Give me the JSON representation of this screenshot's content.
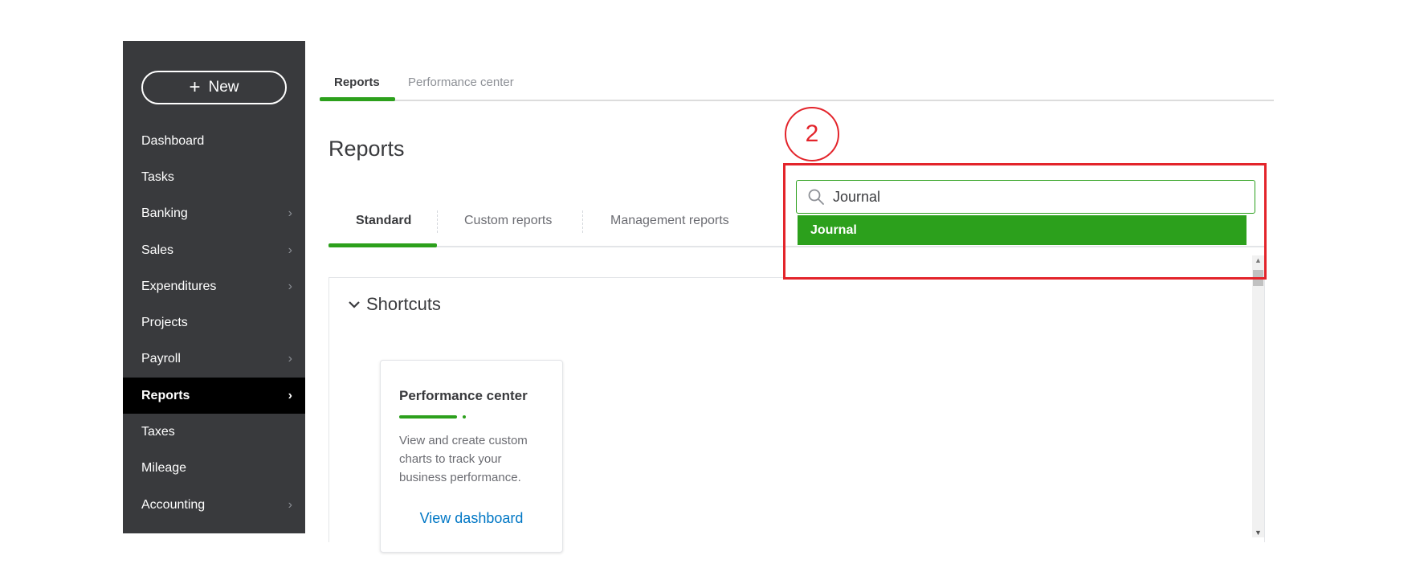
{
  "sidebar": {
    "new_button": {
      "label": "New",
      "icon": "plus-icon"
    },
    "items": [
      {
        "label": "Dashboard",
        "chevron": false
      },
      {
        "label": "Tasks",
        "chevron": false
      },
      {
        "label": "Banking",
        "chevron": true
      },
      {
        "label": "Sales",
        "chevron": true
      },
      {
        "label": "Expenditures",
        "chevron": true
      },
      {
        "label": "Projects",
        "chevron": false
      },
      {
        "label": "Payroll",
        "chevron": true
      },
      {
        "label": "Reports",
        "chevron": true,
        "active": true
      },
      {
        "label": "Taxes",
        "chevron": false
      },
      {
        "label": "Mileage",
        "chevron": false
      },
      {
        "label": "Accounting",
        "chevron": true
      }
    ]
  },
  "top_tabs": {
    "reports": "Reports",
    "performance_center": "Performance center"
  },
  "page_title": "Reports",
  "sub_tabs": {
    "standard": "Standard",
    "custom": "Custom reports",
    "management": "Management reports"
  },
  "search": {
    "value": "Journal",
    "icon": "search-icon"
  },
  "dropdown": {
    "items": [
      "Journal"
    ]
  },
  "shortcuts": {
    "title": "Shortcuts",
    "card": {
      "title": "Performance center",
      "description": "View and create custom charts to track your business performance.",
      "link": "View dashboard"
    }
  },
  "annotation": {
    "step_number": "2"
  },
  "colors": {
    "accent": "#2ca01c",
    "sidebar": "#393a3d",
    "link": "#0077c5",
    "annotation": "#e3242b"
  }
}
